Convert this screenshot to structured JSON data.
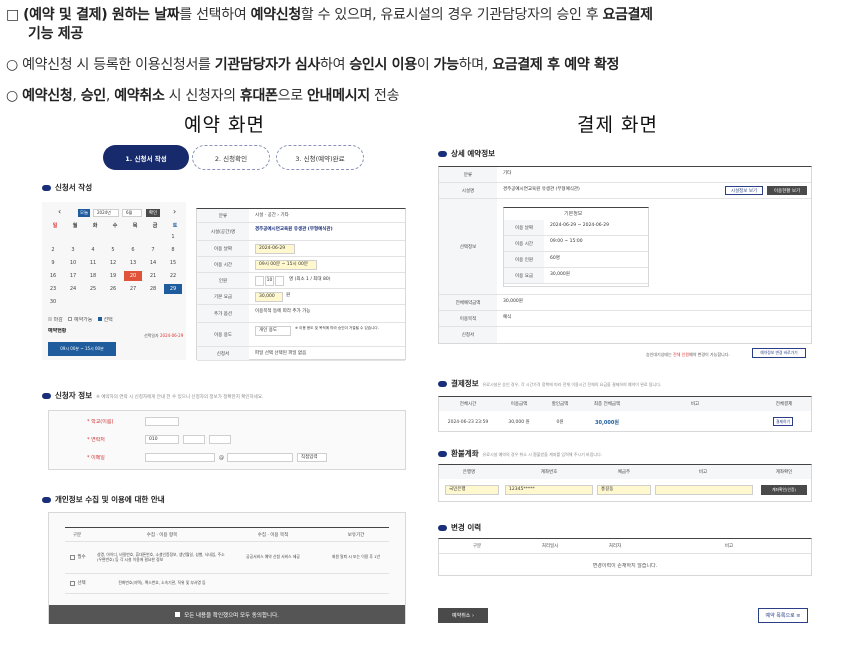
{
  "intro": {
    "line1_prefix": "□ ",
    "line1_b1": "(예약 및 결제) 원하는 날짜",
    "line1_t1": "를 선택하여 ",
    "line1_b2": "예약신청",
    "line1_t2": "할 수 있으며, 유료시설의 경우 기관담당자의 승인 후 ",
    "line1_b3": "요금결제",
    "line1_b4": "기능 제공",
    "line2_t1": "○ 예약신청 시 등록한 이용신청서를 ",
    "line2_b1": "기관담당자가 심사",
    "line2_t2": "하여 ",
    "line2_b2": "승인시 이용",
    "line2_t3": "이 ",
    "line2_b3": "가능",
    "line2_t4": "하며, ",
    "line2_b4": "요금결제 후 예약 확정",
    "line3_t1": "○ ",
    "line3_b1": "예약신청",
    "line3_t2": ", ",
    "line3_b2": "승인",
    "line3_t3": ", ",
    "line3_b3": "예약취소",
    "line3_t4": " 시 신청자의 ",
    "line3_b4": "휴대폰",
    "line3_t5": "으로 ",
    "line3_b5": "안내메시지",
    "line3_t6": " 전송"
  },
  "captions": {
    "reservation": "예약 화면",
    "payment": "결제 화면"
  },
  "reservation_screen": {
    "steps": [
      "1. 신청서 작성",
      "2. 신청확인",
      "3. 신청(예약)완료"
    ],
    "section_form": "신청서 작성",
    "calendar": {
      "today_btn": "오늘",
      "year": "2024년",
      "month": "6월",
      "confirm_btn": "확인",
      "weekdays": [
        "일",
        "월",
        "화",
        "수",
        "목",
        "금",
        "토"
      ],
      "days": [
        "",
        "",
        "",
        "",
        "",
        "",
        "1",
        "2",
        "3",
        "4",
        "5",
        "6",
        "7",
        "8",
        "9",
        "10",
        "11",
        "12",
        "13",
        "14",
        "15",
        "16",
        "17",
        "18",
        "19",
        "20",
        "21",
        "22",
        "23",
        "24",
        "25",
        "26",
        "27",
        "28",
        "29",
        "30"
      ],
      "legend": [
        "마감",
        "예약가능",
        "선택"
      ],
      "status_label": "예약현황",
      "status_date_label": "선택일자",
      "status_date": "2024-06-29",
      "slot": "09시 00분 ~ 15시 00분"
    },
    "form": {
      "rows": [
        {
          "label": "분류",
          "value": "시설 · 공간 › 기타"
        },
        {
          "label": "시설(공간)명",
          "value": "경주공예시연교육원 유생관 (무형예식관)"
        },
        {
          "label": "이용 날짜",
          "value": "2024-06-29"
        },
        {
          "label": "이용 시간",
          "value": "09시 00분 ~ 15시 00분"
        },
        {
          "label": "인원",
          "value": "명 (최소 1 / 최대 80)"
        },
        {
          "label": "기본 요금",
          "value": "30,000"
        },
        {
          "label": "추가 옵션",
          "value": "이용목적 등에 따라 추가 가능"
        },
        {
          "label": "이용 용도",
          "value": "※ 이용 용도 및 목적에 따라 승인이 거절될 수 있습니다."
        },
        {
          "label": "신청서",
          "value": "파일 선택    선택된 파일 없음"
        }
      ],
      "guests_min": "1",
      "guests_max": "10",
      "fee_unit": "원",
      "purpose_select": "개인 용도"
    },
    "section_applicant": "신청자 정보",
    "applicant_note": "※ 예약자의 연락 시 신청자에게 안내 전 수 있으니 신청자의 정보가 정확한지 확인하세요.",
    "applicant_rows": [
      "* 학교(이름)",
      "* 연락처",
      "* 이메일"
    ],
    "phone_prefix": "010",
    "email_at": "@",
    "email_select": "직접입력",
    "section_privacy": "개인정보 수집 및 이용에 대한 안내",
    "privacy_headers": [
      "구분",
      "수집 · 이용 항목",
      "수집 · 이용 목적",
      "보유기간"
    ],
    "privacy_rows": [
      {
        "type": "필수",
        "items": "성명, 아이디, 비밀번호, 휴대폰번호, 소셜인증정보, 생년월일, 성별, 닉네임, 주소(우편번호) 등 각 시설 이용에 필요한 정보",
        "purpose": "공공서비스 예약 신청 서비스 제공",
        "period": "회원 탈퇴 시 또는 이용 후 1년"
      },
      {
        "type": "선택",
        "items": "전화번호(자택), 팩스번호, 소속기관, 직위 및 부서명 등",
        "purpose": "",
        "period": ""
      }
    ],
    "agree_all": "모든 내용을 확인했으며 모두 동의합니다."
  },
  "payment_screen": {
    "section_detail": "상세 예약정보",
    "detail_rows": [
      {
        "label": "분류",
        "value": "기타"
      },
      {
        "label": "시설명",
        "value": "경주공예시연교육원 유생관 (무형예식관)"
      },
      {
        "label": "선택정보",
        "value": ""
      },
      {
        "label": "전체예약금액",
        "value": "30,000원"
      },
      {
        "label": "이용목적",
        "value": "예식"
      },
      {
        "label": "신청서",
        "value": ""
      }
    ],
    "facility_buttons": [
      "시설정보 보기",
      "이용현황 보기"
    ],
    "basic_info": "기본정보",
    "sub_rows": [
      {
        "label": "이용 날짜",
        "value": "2024-06-29 ~ 2024-06-29"
      },
      {
        "label": "이용 시간",
        "value": "09:00 ~ 15:00"
      },
      {
        "label": "이용 인원",
        "value": "60명"
      },
      {
        "label": "이용 요금",
        "value": "30,000원"
      }
    ],
    "cancel_note_prefix": "승인대기상태는 ",
    "cancel_note_red": "전체 인원",
    "cancel_note_suffix": "예약 변경이 가능합니다.",
    "cancel_change_btn": "예약정보 변경 바로가기",
    "section_pay": "결제정보",
    "pay_note": "유료시설은 승인 경우, 각 시간가격 정책에 따라 전체 이용시간 전체의 요금을 결제하여 예약이 완료 됩니다.",
    "pay_headers": [
      "전체시간",
      "이용금액",
      "할인금액",
      "최종 전체금액",
      "비고",
      "전체결제"
    ],
    "pay_row": [
      "2024-06-23 23:59",
      "30,000 원",
      "0원",
      "30,000원",
      "",
      ""
    ],
    "pay_btn": "결제하기",
    "section_refund": "환불계좌",
    "refund_note": "유료시설 예약의 경우 취소 시 환불받을 계좌를 입력해 주시기 바랍니다.",
    "refund_headers": [
      "은행명",
      "계좌번호",
      "예금주",
      "비고",
      "계좌확인"
    ],
    "refund_row": [
      "국민은행",
      "12345*****",
      "홍길동",
      ""
    ],
    "refund_btn": "계좌확인(인증)",
    "section_history": "변경 이력",
    "history_headers": [
      "구분",
      "처리일시",
      "처리자",
      "비고"
    ],
    "history_empty": "변경이력이 존재하지 않습니다.",
    "bottom_left_btn": "예약취소",
    "bottom_right_btn": "예약 목록으로"
  }
}
